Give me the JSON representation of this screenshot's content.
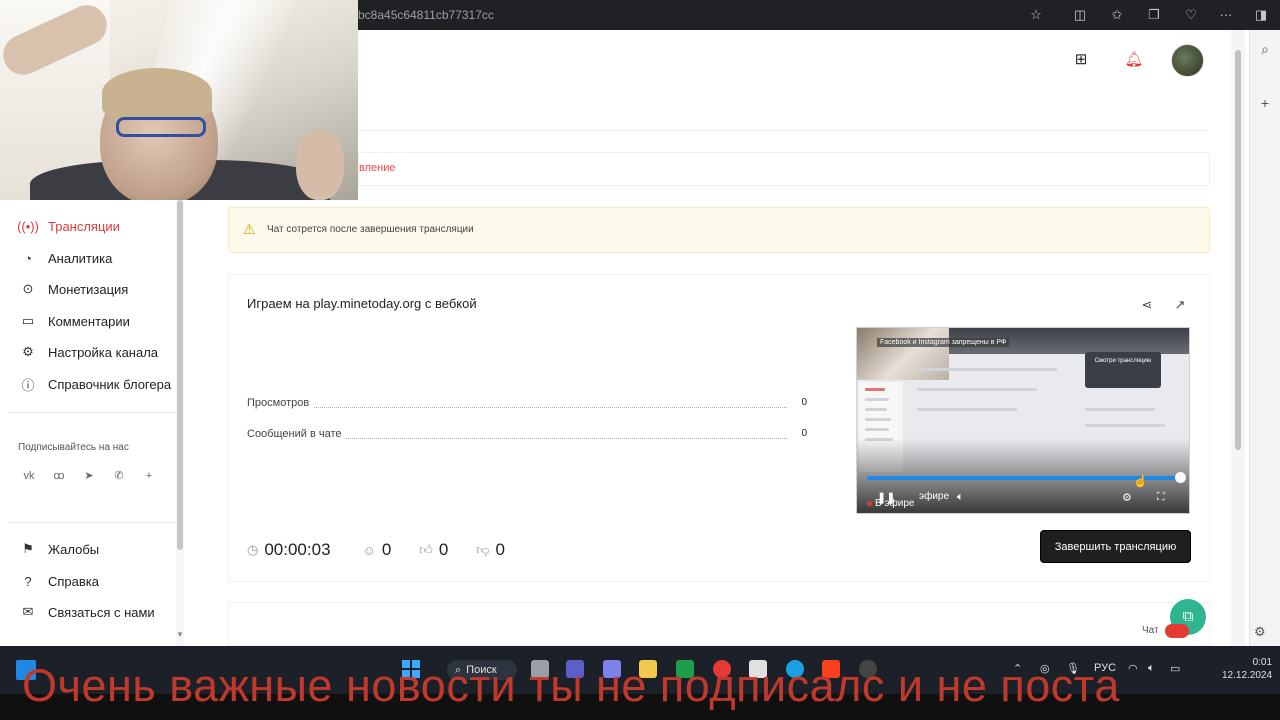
{
  "browser": {
    "url_fragment": "bc8a45c64811cb77317cc",
    "icons": [
      "star-icon",
      "split-view-icon",
      "favorites-icon",
      "collections-icon",
      "extensions-icon",
      "more-icon",
      "sidebar-icon"
    ]
  },
  "header": {
    "icons": [
      "create-icon",
      "bell-icon"
    ]
  },
  "tabs": {
    "active_partial": "вление"
  },
  "sidebar": {
    "items": [
      {
        "label": "Трансляции",
        "icon": "broadcast-icon",
        "active": true
      },
      {
        "label": "Аналитика",
        "icon": "analytics-icon"
      },
      {
        "label": "Монетизация",
        "icon": "monetization-icon"
      },
      {
        "label": "Комментарии",
        "icon": "comments-icon"
      },
      {
        "label": "Настройка канала",
        "icon": "settings-icon"
      },
      {
        "label": "Справочник блогера",
        "icon": "guide-icon"
      }
    ],
    "follow_label": "Подписывайтесь на нас",
    "socials": [
      "vk-icon",
      "ok-icon",
      "telegram-icon",
      "viber-icon",
      "plus-icon"
    ],
    "bottom_items": [
      {
        "label": "Жалобы",
        "icon": "flag-icon"
      },
      {
        "label": "Справка",
        "icon": "help-icon"
      },
      {
        "label": "Связаться с нами",
        "icon": "mail-icon"
      }
    ]
  },
  "alert": {
    "text": "Чат сотрется после завершения трансляции"
  },
  "stream": {
    "title": "Играем на play.minetoday.org с вебкой",
    "stats": [
      {
        "label": "Просмотров",
        "value": "0"
      },
      {
        "label": "Сообщений в чате",
        "value": "0"
      }
    ],
    "timer": "00:00:03",
    "viewers": "0",
    "likes": "0",
    "dislikes": "0",
    "end_button": "Завершить трансляцию"
  },
  "video": {
    "banner": "Facebook и Instagram запрещены в РФ",
    "button_text": "Смотри трансляцию",
    "live_label": "В эфире",
    "live_partial": "эфире",
    "progress": 1.0
  },
  "chat": {
    "label": "Чат"
  },
  "taskbar": {
    "search": "Поиск",
    "lang": "РУС",
    "time": "0:01",
    "date": "12.12.2024"
  },
  "overlay": {
    "subtitle": "Очень важные новости ты не подписалс и не поста"
  },
  "colors": {
    "accent_red": "#e53935",
    "button_dark": "#1f1f1f",
    "alert_bg": "#fdfaeb",
    "progress_blue": "#1e88e5",
    "chat_fab": "#2fb58f",
    "subtitle_red": "#c0392b"
  }
}
